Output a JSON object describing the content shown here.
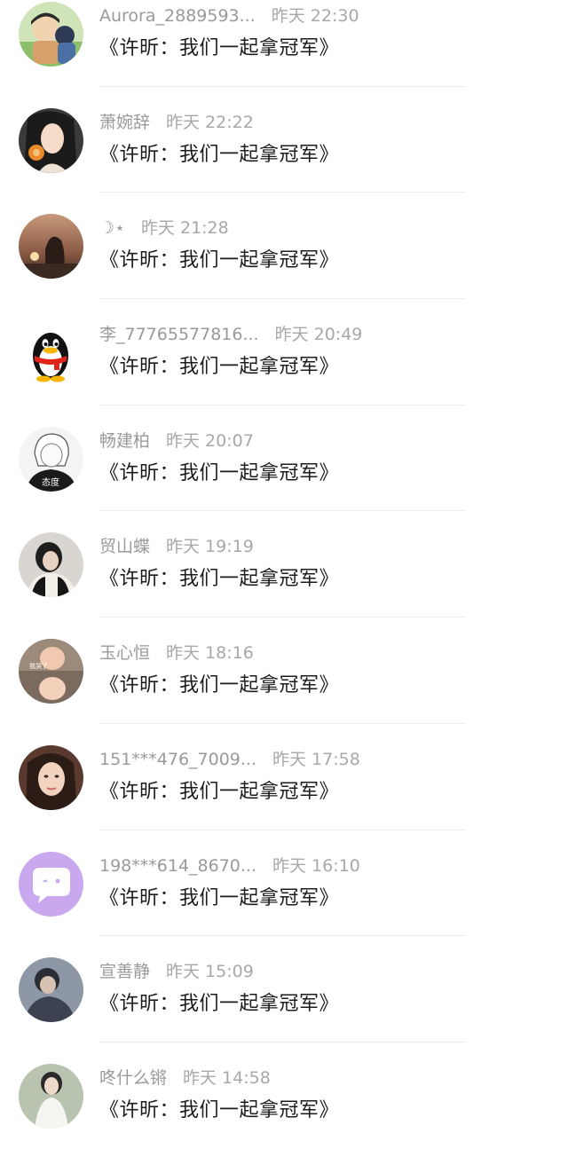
{
  "comments": [
    {
      "name": "Aurora_2889593...",
      "time": "昨天 22:30",
      "text": "《许昕：我们一起拿冠军》",
      "avatar": "cartoon-avatar"
    },
    {
      "name": "萧婉辞",
      "time": "昨天 22:22",
      "text": "《许昕：我们一起拿冠军》",
      "avatar": "photo-avatar"
    },
    {
      "name": "☽⋆",
      "time": "昨天 21:28",
      "text": "《许昕：我们一起拿冠军》",
      "avatar": "sunset-avatar"
    },
    {
      "name": "李_77765577816...",
      "time": "昨天 20:49",
      "text": "《许昕：我们一起拿冠军》",
      "avatar": "penguin-avatar"
    },
    {
      "name": "畅建柏",
      "time": "昨天 20:07",
      "text": "《许昕：我们一起拿冠军》",
      "avatar": "anime-avatar"
    },
    {
      "name": "贸山蝶",
      "time": "昨天 19:19",
      "text": "《许昕：我们一起拿冠军》",
      "avatar": "photo-avatar"
    },
    {
      "name": "玉心恒",
      "time": "昨天 18:16",
      "text": "《许昕：我们一起拿冠军》",
      "avatar": "baby-avatar",
      "avatar_text": [
        "我哭了",
        "我"
      ]
    },
    {
      "name": "151***476_7009...",
      "time": "昨天 17:58",
      "text": "《许昕：我们一起拿冠军》",
      "avatar": "portrait-avatar"
    },
    {
      "name": "198***614_8670...",
      "time": "昨天 16:10",
      "text": "《许昕：我们一起拿冠军》",
      "avatar": "chat-bubble-avatar"
    },
    {
      "name": "宣善静",
      "time": "昨天 15:09",
      "text": "《许昕：我们一起拿冠军》",
      "avatar": "photo-avatar"
    },
    {
      "name": "咚什么锵",
      "time": "昨天 14:58",
      "text": "《许昕：我们一起拿冠军》",
      "avatar": "photo-avatar"
    }
  ],
  "colors": {
    "username": "#9a9a9a",
    "timestamp": "#a8a8a8",
    "comment_text": "#1c1c1c",
    "divider": "#ececec",
    "chat_avatar_bg": "#c9a8f0"
  }
}
